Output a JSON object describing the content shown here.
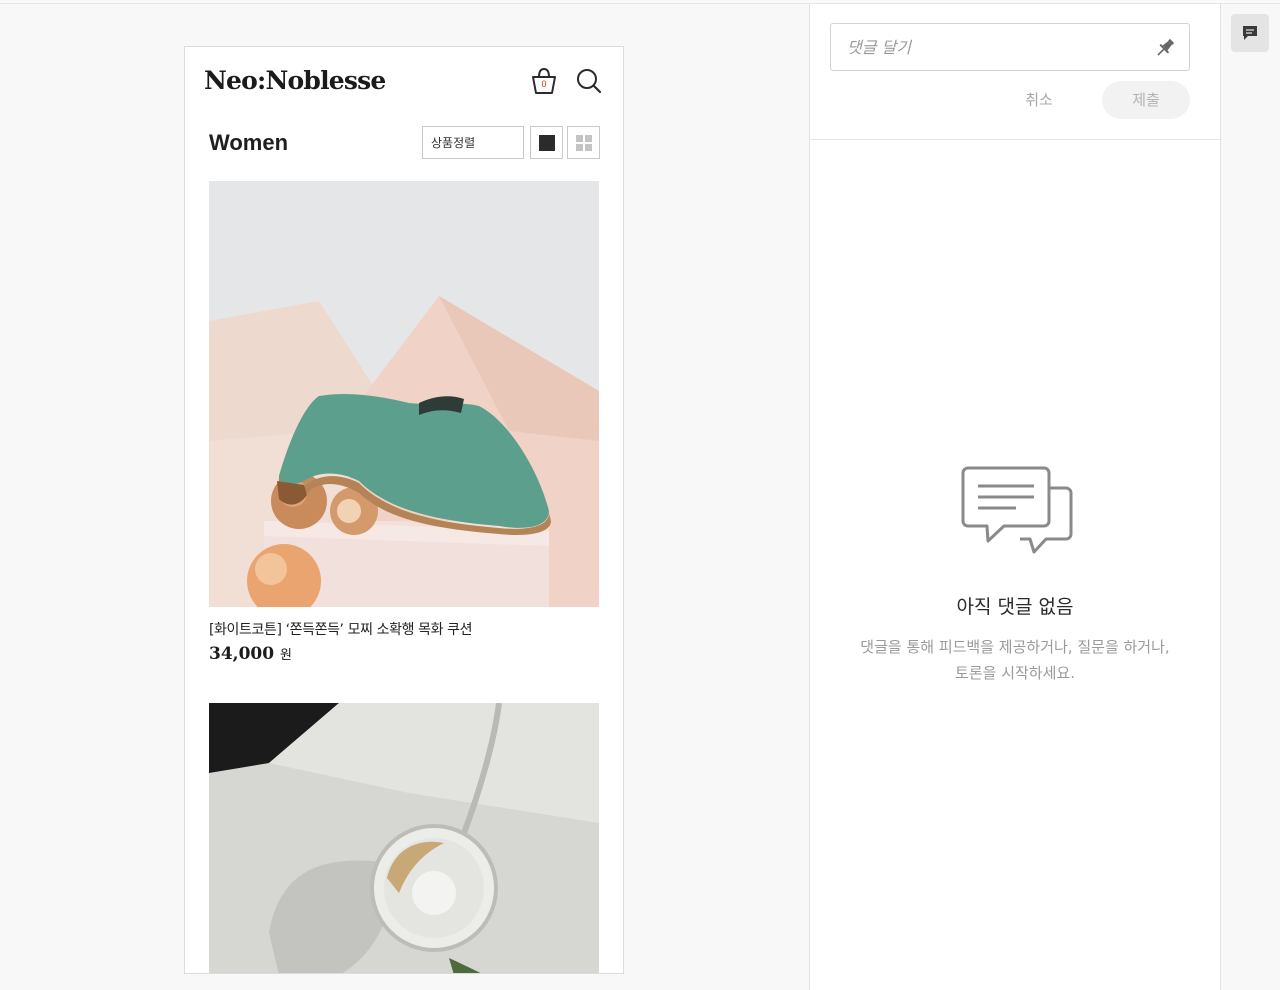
{
  "store": {
    "logo": "Neo:Noblesse",
    "cart_count": "0",
    "category_title": "Women",
    "sort_label": "상품정렬"
  },
  "products": [
    {
      "name": "[화이트코튼] ‘쫀득쫀득’ 모찌 소확행 목화 쿠션",
      "price": "34,000",
      "currency": "원"
    }
  ],
  "comments": {
    "input_placeholder": "댓글 달기",
    "cancel_label": "취소",
    "submit_label": "제출",
    "empty_title": "아직 댓글 없음",
    "empty_desc_line1": "댓글을 통해 피드백을 제공하거나, 질문을 하거나,",
    "empty_desc_line2": "토론을 시작하세요."
  },
  "icons": {
    "cart": "cart-icon",
    "search": "search-icon",
    "single_view": "single-view-icon",
    "grid_view": "grid-view-icon",
    "pin": "pin-icon",
    "empty_comments": "chat-bubbles-icon",
    "rail_comment": "comment-icon"
  },
  "colors": {
    "cart_count": "#d62b2b",
    "accent_dark": "#2b2b2b",
    "muted_text": "#9a9a9a"
  }
}
